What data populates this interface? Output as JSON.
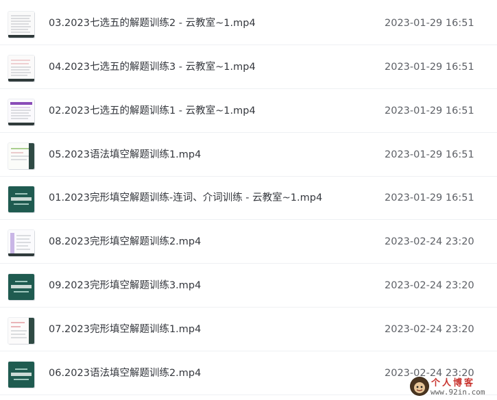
{
  "files": [
    {
      "name": "03.2023七选五的解题训练2 - 云教室~1.mp4",
      "date": "2023-01-29 16:51",
      "thumb": "doc-text"
    },
    {
      "name": "04.2023七选五的解题训练3 - 云教室~1.mp4",
      "date": "2023-01-29 16:51",
      "thumb": "doc-pink"
    },
    {
      "name": "02.2023七选五的解题训练1 - 云教室~1.mp4",
      "date": "2023-01-29 16:51",
      "thumb": "doc-purple"
    },
    {
      "name": "05.2023语法填空解题训练1.mp4",
      "date": "2023-01-29 16:51",
      "thumb": "doc-green"
    },
    {
      "name": "01.2023完形填空解题训练-连词、介词训练 - 云教室~1.mp4",
      "date": "2023-01-29 16:51",
      "thumb": "dark-teal"
    },
    {
      "name": "08.2023完形填空解题训练2.mp4",
      "date": "2023-02-24 23:20",
      "thumb": "doc-lavender"
    },
    {
      "name": "09.2023完形填空解题训练3.mp4",
      "date": "2023-02-24 23:20",
      "thumb": "dark-teal"
    },
    {
      "name": "07.2023完形填空解题训练1.mp4",
      "date": "2023-02-24 23:20",
      "thumb": "doc-red"
    },
    {
      "name": "06.2023语法填空解题训练2.mp4",
      "date": "2023-02-24 23:20",
      "thumb": "dark-teal"
    }
  ],
  "watermark": {
    "title": "个人博客",
    "url": "www.92in.com"
  }
}
